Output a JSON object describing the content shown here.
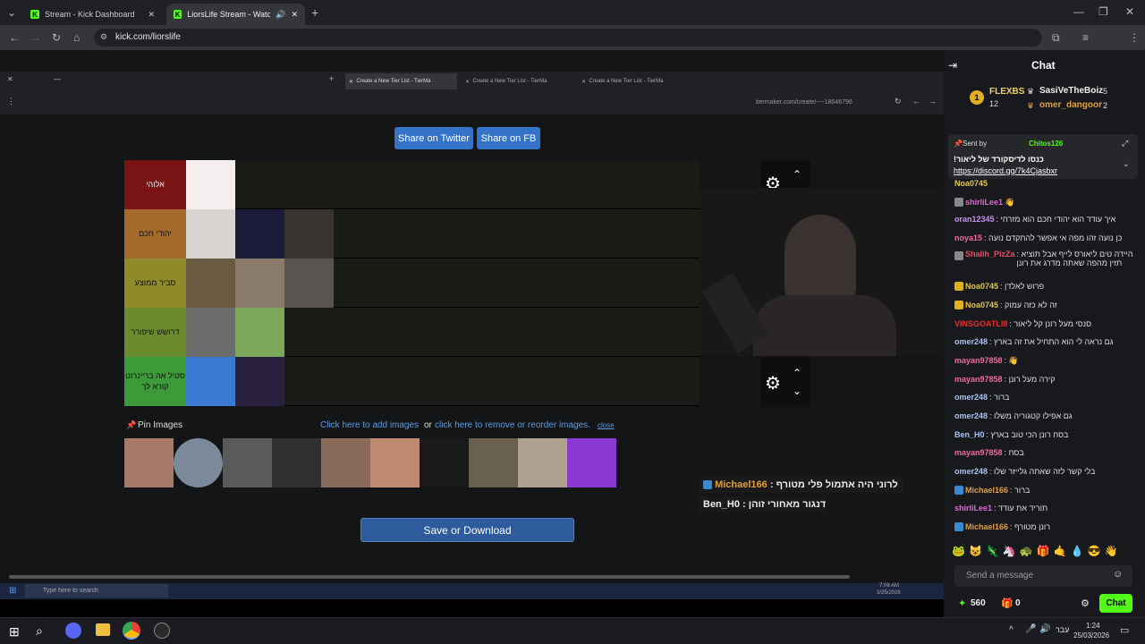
{
  "browser": {
    "tabs": [
      {
        "title": "Stream - Kick Dashboard",
        "active": false
      },
      {
        "title": "LiorsLife Stream - Watch Liv",
        "active": true
      }
    ],
    "url": "kick.com/liorslife"
  },
  "stream": {
    "inner_tabs": [
      "Create a New Tier List - TierMa",
      "Create a New Tier List - TierMa",
      "Create a New Tier List - TierMa"
    ],
    "inner_url": "tiermaker.com/create/----18646796",
    "share_twitter": "Share on Twitter",
    "share_fb": "Share on FB",
    "tiers": [
      {
        "label": "אלוהי",
        "color": "#7a1414",
        "label_color": "#eee"
      },
      {
        "label": "יהודי חכם",
        "color": "#a36a2c",
        "label_color": "#111"
      },
      {
        "label": "סביר ממוצע",
        "color": "#8f8a2a",
        "label_color": "#111"
      },
      {
        "label": "דרושש שיפורר",
        "color": "#6b8c2e",
        "label_color": "#111"
      },
      {
        "label": "סטיל אה בריינרוט קורא לך",
        "color": "#3c9a38",
        "label_color": "#111"
      }
    ],
    "pin_images": "Pin Images",
    "add_images_link": "Click here to add images",
    "or_text": "or",
    "reorder_link": "click here to remove or reorder images.",
    "close_link": "close",
    "save_button": "Save or Download",
    "overlay_messages": [
      {
        "user": "Michael166",
        "text": ": לרוני היה אתמול פלי מטורף"
      },
      {
        "user": "Ben_H0",
        "text": ": דנגור מאחורי זוהן"
      }
    ],
    "taskbar_search": "Type here to search",
    "clock_time": "7:08 AM",
    "clock_date": "3/25/2026"
  },
  "chat": {
    "title": "Chat",
    "leaderboard": [
      {
        "user": "FLEXBS",
        "count": "12"
      },
      {
        "user": "SasiVeTheBoiz",
        "count": "5"
      },
      {
        "user": "omer_dangoor",
        "count": "2"
      }
    ],
    "pinned": {
      "sent_by_label": "Sent by",
      "sender": "Chitos126",
      "text": "!כנסו לדיסקורד של ליאור",
      "link": "https://discord.gg/7k4Cjasbxr"
    },
    "messages": [
      {
        "user": "Noa0745",
        "text": "",
        "color": "#e0c650"
      },
      {
        "user": "shirliLee1",
        "text": "",
        "color": "#d86bd0"
      },
      {
        "user": "oran12345",
        "text": ": איך עודד הוא יהודי חכם הוא מזרחי",
        "color": "#c98cf0"
      },
      {
        "user": "noya15",
        "text": ": כן נועה זהו מפה אי אפשר להתקדם נועה",
        "color": "#f06a9e"
      },
      {
        "user": "Shalih_PizZa",
        "text": ": היידה טים ליאורס לייף אבל תוציא תזין מהפה שאתה מדרג את רונן",
        "color": "#e0506a"
      },
      {
        "user": "Noa0745",
        "text": ": פרוש לאלדן",
        "color": "#e0c650"
      },
      {
        "user": "Noa0745",
        "text": ": זה לא כזה עמוק",
        "color": "#e0c650"
      },
      {
        "user": "VINSGOATLI8",
        "text": ": סנסי מעל רונן קל ליאור",
        "color": "#e03030"
      },
      {
        "user": "omer248",
        "text": ": גם נראה לי הוא התחיל את זה בארץ",
        "color": "#a7c4f0"
      },
      {
        "user": "mayan97858",
        "text": "",
        "color": "#f06a9e"
      },
      {
        "user": "mayan97858",
        "text": ": קירה מעל רונן",
        "color": "#f06a9e"
      },
      {
        "user": "omer248",
        "text": ": ברור",
        "color": "#a7c4f0"
      },
      {
        "user": "omer248",
        "text": ": גם אפילו קטגוריה משלו",
        "color": "#a7c4f0"
      },
      {
        "user": "Ben_H0",
        "text": ": בסח רונן הכי טוב בארץ",
        "color": "#a7c4f0"
      },
      {
        "user": "mayan97858",
        "text": ": בסח",
        "color": "#f06a9e"
      },
      {
        "user": "omer248",
        "text": ": בלי קשר לזה שאתה גלייזר שלו",
        "color": "#a7c4f0"
      },
      {
        "user": "Michael166",
        "text": ": ברור",
        "color": "#e0a040"
      },
      {
        "user": "shirliLee1",
        "text": ": תוריד את עודד",
        "color": "#d86bd0"
      },
      {
        "user": "Michael166",
        "text": ": רונן מטורף",
        "color": "#e0a040"
      }
    ],
    "input_placeholder": "Send a message",
    "points": "560",
    "gifts": "0",
    "chat_button": "Chat"
  },
  "os": {
    "lang": "עבר",
    "time": "1:24",
    "date": "25/03/2026"
  }
}
